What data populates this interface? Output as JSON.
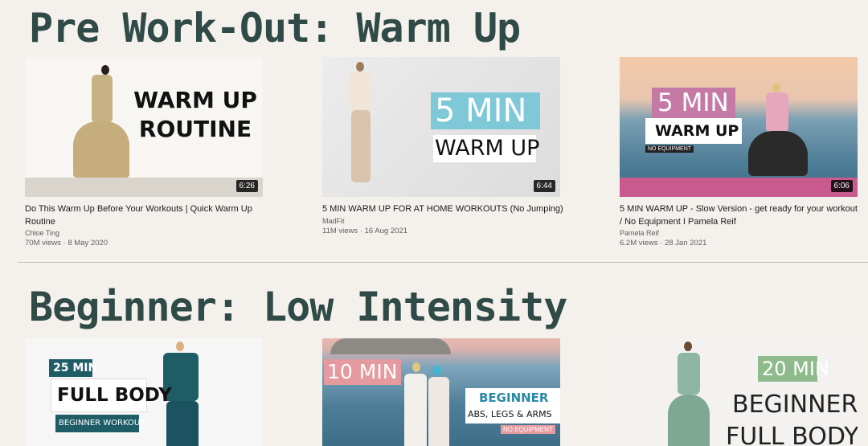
{
  "sections": [
    {
      "title": "Pre Work-Out: Warm Up",
      "videos": [
        {
          "duration": "6:26",
          "title": "Do This Warm Up Before Your Workouts | Quick Warm Up Routine",
          "channel": "Chloe Ting",
          "views": "70M views",
          "date": "8 May 2020",
          "thumb_text": [
            "WARM UP",
            "ROUTINE"
          ]
        },
        {
          "duration": "6:44",
          "title": "5 MIN WARM UP FOR AT HOME WORKOUTS (No Jumping)",
          "channel": "MadFit",
          "views": "11M views",
          "date": "16 Aug 2021",
          "thumb_text": [
            "5 MIN",
            "WARM UP"
          ]
        },
        {
          "duration": "6:06",
          "title": "5 MIN WARM UP - Slow Version - get ready for your workout / No Equipment I Pamela Reif",
          "channel": "Pamela Reif",
          "views": "6.2M views",
          "date": "28 Jan 2021",
          "thumb_text": [
            "5 MIN",
            "WARM UP",
            "NO EQUIPMENT"
          ]
        }
      ]
    },
    {
      "title": "Beginner: Low Intensity",
      "videos": [
        {
          "thumb_text": [
            "25 MIN",
            "FULL BODY",
            "BEGINNER WORKOUT"
          ]
        },
        {
          "thumb_text": [
            "10 MIN",
            "BEGINNER",
            "ABS, LEGS & ARMS",
            "NO EQUIPMENT"
          ]
        },
        {
          "thumb_text": [
            "20 MIN",
            "BEGINNER",
            "FULL BODY"
          ]
        }
      ]
    }
  ],
  "colors": {
    "title": "#2f4a47",
    "background": "#f4f0eb",
    "teal_label": "#1f5d66",
    "pink_label": "#c57aa5",
    "blue_label": "#7fc8d8",
    "green_label": "#8fba8b"
  }
}
